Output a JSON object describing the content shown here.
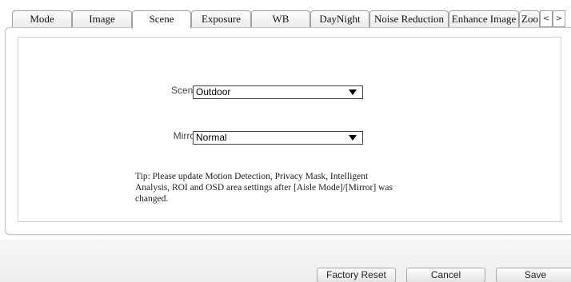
{
  "tabs": [
    {
      "label": "Mode"
    },
    {
      "label": "Image"
    },
    {
      "label": "Scene"
    },
    {
      "label": "Exposure"
    },
    {
      "label": "WB"
    },
    {
      "label": "DayNight"
    },
    {
      "label": "Noise Reduction"
    },
    {
      "label": "Enhance Image"
    },
    {
      "label": "Zoo"
    }
  ],
  "active_tab": "Scene",
  "tab_scroll": {
    "left": "<",
    "right": ">"
  },
  "form": {
    "scene": {
      "label": "Scene",
      "value": "Outdoor"
    },
    "mirror": {
      "label": "Mirror",
      "value": "Normal"
    }
  },
  "tip": "Tip: Please update Motion Detection, Privacy Mask, Intelligent Analysis, ROI and OSD area settings after [Aisle Mode]/[Mirror] was changed.",
  "buttons": {
    "factory_reset": "Factory Reset",
    "cancel": "Cancel",
    "save": "Save"
  }
}
